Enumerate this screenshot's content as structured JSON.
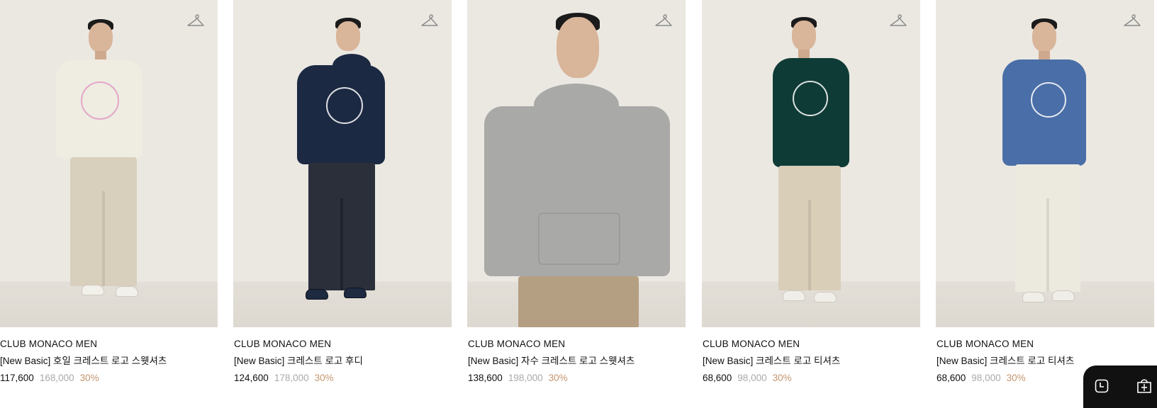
{
  "products": [
    {
      "brand": "CLUB MONACO MEN",
      "name": "[New Basic] 호일 크레스트 로고 스웻셔츠",
      "sale_price": "117,600",
      "original_price": "168,000",
      "discount": "30%",
      "colors": {
        "top": "#efece2",
        "pants": "#d8cfbd",
        "shoes": "#f2f0ea",
        "crest": "pink"
      }
    },
    {
      "brand": "CLUB MONACO MEN",
      "name": "[New Basic] 크레스트 로고 후디",
      "sale_price": "124,600",
      "original_price": "178,000",
      "discount": "30%",
      "colors": {
        "top": "#1c2942",
        "pants": "#2b2f3a",
        "shoes": "#1e2a40",
        "crest": "white"
      }
    },
    {
      "brand": "CLUB MONACO MEN",
      "name": "[New Basic] 자수 크레스트 로고 스웻셔츠",
      "sale_price": "138,600",
      "original_price": "198,000",
      "discount": "30%",
      "colors": {
        "top": "#a9a9a8",
        "pants": "#b59f82",
        "shoes": "",
        "crest": ""
      }
    },
    {
      "brand": "CLUB MONACO MEN",
      "name": "[New Basic] 크레스트 로고 티셔츠",
      "sale_price": "68,600",
      "original_price": "98,000",
      "discount": "30%",
      "colors": {
        "top": "#0f3b36",
        "pants": "#d9ceb8",
        "shoes": "#f0eee8",
        "crest": "white"
      }
    },
    {
      "brand": "CLUB MONACO MEN",
      "name": "[New Basic] 크레스트 로고 티셔츠",
      "sale_price": "68,600",
      "original_price": "98,000",
      "discount": "30%",
      "colors": {
        "top": "#4a6ea7",
        "pants": "#ece9df",
        "shoes": "#f0eee8",
        "crest": "white"
      }
    }
  ],
  "icons": {
    "wishlist": "hanger-icon",
    "recent": "clock-icon",
    "bag": "shopping-bag-icon"
  },
  "theme": {
    "discount_color": "#c49670",
    "original_price_color": "#a9a9a9",
    "panel_color": "#111111"
  }
}
